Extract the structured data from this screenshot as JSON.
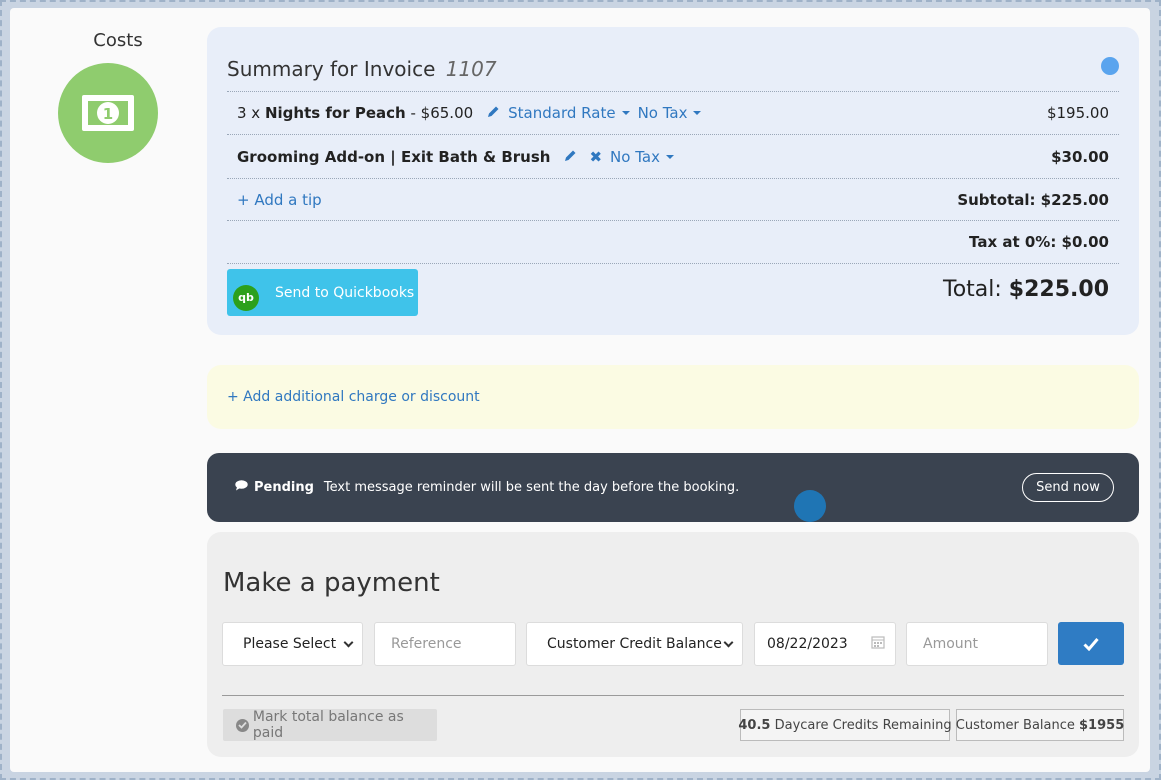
{
  "costs": {
    "title": "Costs"
  },
  "summary": {
    "title": "Summary for Invoice",
    "invoice_number": "1107",
    "lines": [
      {
        "qty_prefix": "3 x ",
        "name": "Nights for Peach",
        "unit_price": " - $65.00",
        "rate": "Standard Rate",
        "tax": "No Tax",
        "amount": "$195.00"
      },
      {
        "name": "Grooming Add-on | Exit Bath & Brush",
        "tax": "No Tax",
        "amount": "$30.00"
      }
    ],
    "add_tip": "+ Add a tip",
    "subtotal": "Subtotal: $225.00",
    "tax_line": "Tax at 0%: $0.00",
    "quickbooks_logo": "qb",
    "quickbooks_button": "Send to Quickbooks",
    "total_label": "Total:",
    "total_value": "$225.00"
  },
  "additional": {
    "link": "+ Add additional charge or discount"
  },
  "pending": {
    "label": "Pending",
    "message": "Text message reminder will be sent the day before the booking.",
    "send_now": "Send now"
  },
  "payment": {
    "title": "Make a payment",
    "method_select": "Please Select",
    "reference_placeholder": "Reference",
    "source_select": "Customer Credit Balance",
    "date": "08/22/2023",
    "amount_placeholder": "Amount",
    "mark_paid": "Mark total balance as paid",
    "daycare_credits_value": "40.5",
    "daycare_credits_label": " Daycare Credits Remaining",
    "customer_balance_label": "Customer Balance ",
    "customer_balance_value": "$1955"
  },
  "colors": {
    "costs_circle": "#8fcc6e",
    "summary_bg": "#e8eef9",
    "status_dot": "#5aa4ee",
    "quickbooks_btn": "#3fc3ea",
    "pending_bg": "#3a4350",
    "confirm_btn": "#2f7cc4",
    "link": "#3078c0"
  }
}
